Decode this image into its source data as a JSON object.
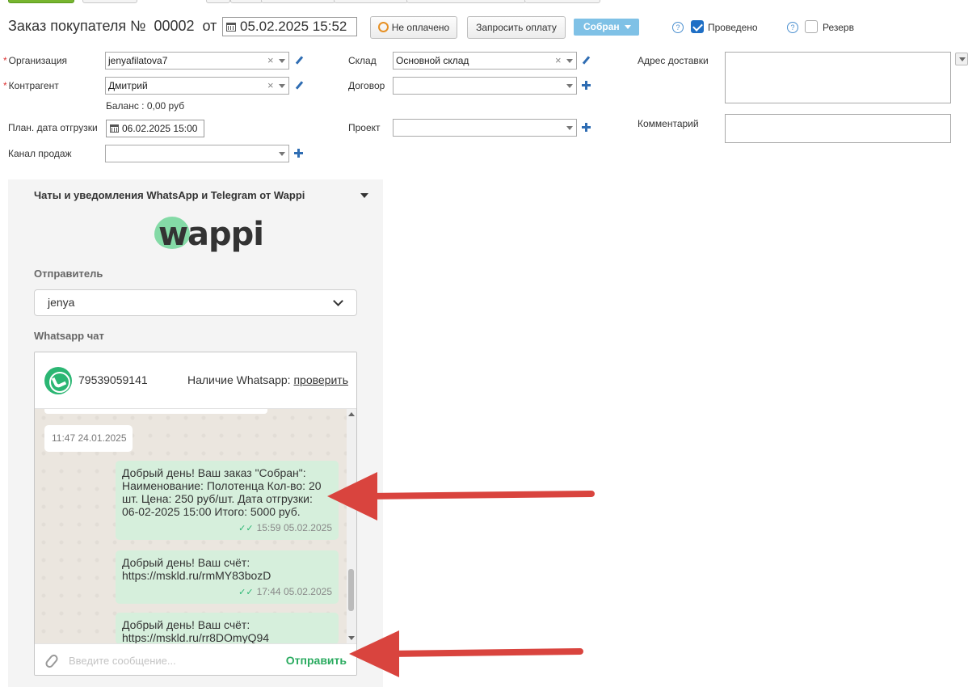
{
  "header": {
    "title": "Заказ покупателя №",
    "number": "00002",
    "from_label": "от",
    "datetime": "05.02.2025 15:52",
    "payment_status": "Не оплачено",
    "request_payment": "Запросить оплату",
    "state": "Собран",
    "posted_label": "Проведено",
    "reserve_label": "Резерв",
    "help_glyph": "?"
  },
  "form": {
    "org_label": "Организация",
    "org_value": "jenyafilatova7",
    "counterparty_label": "Контрагент",
    "counterparty_value": "Дмитрий",
    "balance": "Баланс : 0,00 руб",
    "ship_date_label": "План. дата отгрузки",
    "ship_date_value": "06.02.2025 15:00",
    "channel_label": "Канал продаж",
    "warehouse_label": "Склад",
    "warehouse_value": "Основной склад",
    "contract_label": "Договор",
    "project_label": "Проект",
    "address_label": "Адрес доставки",
    "comment_label": "Комментарий",
    "required_mark": "*",
    "clear_glyph": "×"
  },
  "wappi": {
    "title": "Чаты и уведомления WhatsApp и Telegram от Wappi",
    "logo_text": "wappi",
    "sender_label": "Отправитель",
    "sender_value": "jenya",
    "chat_label": "Whatsapp чат",
    "phone": "79539059141",
    "availability_label": "Наличие Whatsapp:",
    "check_link": "проверить",
    "separator_time": "11:47 24.01.2025",
    "messages": [
      {
        "text": "Добрый день! Ваш заказ \"Собран\": Наименование: Полотенца Кол-во: 20 шт. Цена: 250 руб/шт. Дата отгрузки: 06-02-2025 15:00 Итого: 5000 руб.",
        "time": "15:59 05.02.2025"
      },
      {
        "text": "Добрый день! Ваш счёт: https://mskld.ru/rmMY83bozD",
        "time": "17:44 05.02.2025"
      },
      {
        "text": "Добрый день! Ваш счёт: https://mskld.ru/rr8DOmyQ94",
        "time": ""
      }
    ],
    "input_placeholder": "Введите сообщение...",
    "send_label": "Отправить",
    "tick_glyph": "✓✓"
  },
  "colors": {
    "arrow": "#d9443e",
    "whatsapp_green": "#2bb673",
    "state_blue": "#7fc1e6",
    "bubble_out": "#d6efdc"
  }
}
